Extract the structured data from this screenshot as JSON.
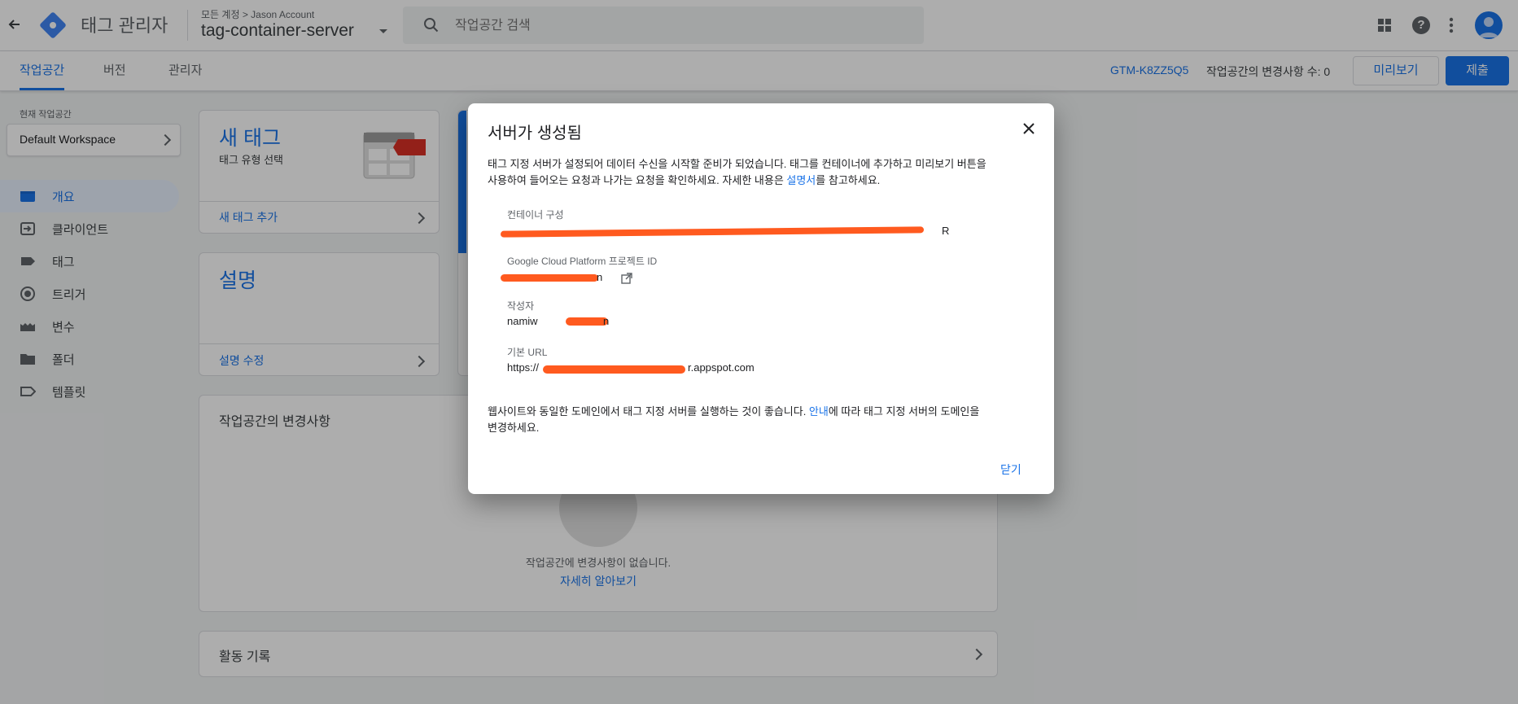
{
  "header": {
    "app_title": "태그 관리자",
    "breadcrumb": "모든 계정 > Jason Account",
    "container_name": "tag-container-server",
    "search_placeholder": "작업공간 검색"
  },
  "tabs": [
    {
      "label": "작업공간"
    },
    {
      "label": "버전"
    },
    {
      "label": "관리자"
    }
  ],
  "toolbar": {
    "container_id": "GTM-K8ZZ5Q5",
    "changes_count": "작업공간의 변경사항 수: 0",
    "preview_label": "미리보기",
    "submit_label": "제출"
  },
  "sidebar": {
    "workspace_caption": "현재 작업공간",
    "workspace_name": "Default Workspace",
    "items": [
      {
        "label": "개요",
        "icon": "overview-icon"
      },
      {
        "label": "클라이언트",
        "icon": "client-icon"
      },
      {
        "label": "태그",
        "icon": "tag-icon"
      },
      {
        "label": "트리거",
        "icon": "trigger-icon"
      },
      {
        "label": "변수",
        "icon": "variable-icon"
      },
      {
        "label": "폴더",
        "icon": "folder-icon"
      },
      {
        "label": "템플릿",
        "icon": "template-icon"
      }
    ]
  },
  "cards": {
    "new_tag_title": "새 태그",
    "new_tag_sub": "태그 유형 선택",
    "new_tag_link": "새 태그 추가",
    "desc_title": "설명",
    "desc_link": "설명 수정",
    "changes_title": "작업공간의 변경사항",
    "changes_empty": "작업공간에 변경사항이 없습니다.",
    "changes_learn": "자세히 알아보기",
    "activity_title": "활동 기록"
  },
  "dialog": {
    "title": "서버가 생성됨",
    "intro_1": "태그 지정 서버가 설정되어 데이터 수신을 시작할 준비가 되었습니다. 태그를 컨테이너에 추가하고 미리보기 버튼을",
    "intro_2": "사용하여 들어오는 요청과 나가는 요청을 확인하세요. 자세한 내용은 ",
    "intro_link": "설명서",
    "intro_3": "를 참고하세요.",
    "fields": [
      {
        "label": "컨테이너 구성",
        "value": "R"
      },
      {
        "label": "Google Cloud Platform 프로젝트 ID",
        "value": "n"
      },
      {
        "label": "작성자",
        "value": "namiw"
      },
      {
        "label": "기본 URL",
        "value": "https://"
      }
    ],
    "base_url_tail": "r.appspot.com",
    "author_tail": "n",
    "outro_1": "웹사이트와 동일한 도메인에서 태그 지정 서버를 실행하는 것이 좋습니다. ",
    "outro_link": "안내",
    "outro_2": "에 따라 태그 지정 서버의 도메인을",
    "outro_3": "변경하세요.",
    "close_label": "닫기"
  },
  "colors": {
    "accent": "#1a73e8",
    "redaction": "#ff5a1f"
  }
}
